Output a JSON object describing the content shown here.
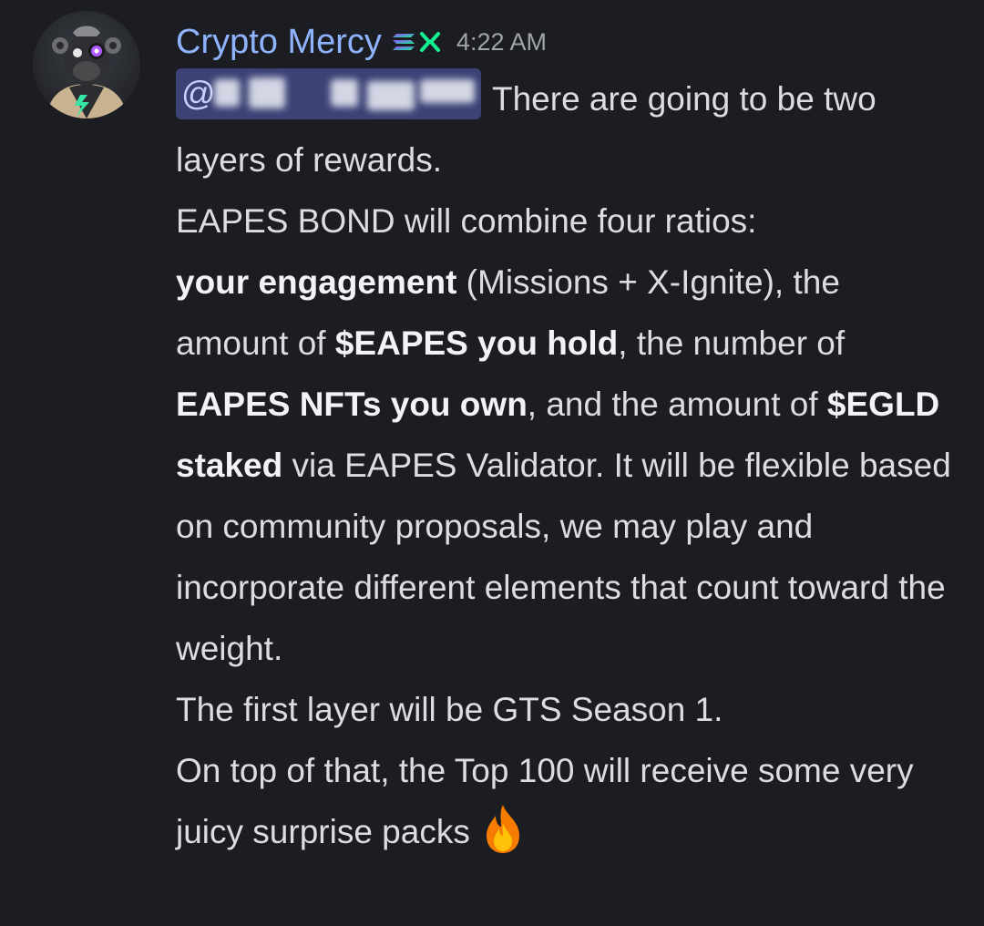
{
  "message": {
    "author": "Crypto Mercy",
    "timestamp": "4:22 AM",
    "author_color": "#8fb4ff",
    "badge_icon": "solana-logo-icon",
    "avatar_icon": "ape-avatar-icon",
    "mention": {
      "prefix": "@",
      "redacted": true,
      "background": "#3c4276"
    },
    "lines": {
      "l1": "There are going to be two layers of rewards.",
      "l2": "EAPES BOND will combine four ratios:",
      "l3_bold1": "your engagement",
      "l3_a": " (Missions + X-Ignite),",
      "l3_b": " the amount of ",
      "l3_bold2": "$EAPES you hold",
      "l3_c": ", the number of ",
      "l3_bold3": "EAPES NFTs you own",
      "l3_d": ", and the amount of ",
      "l3_bold4": "$EGLD staked",
      "l3_e": " via EAPES Validator. It will be flexible based on community proposals, we may play and incorporate different elements that count toward the weight.",
      "l4": "The first layer will be GTS Season 1.",
      "l5": "On top of that, the Top 100 will receive some very juicy surprise packs"
    },
    "emoji": "fire-emoji-icon"
  }
}
